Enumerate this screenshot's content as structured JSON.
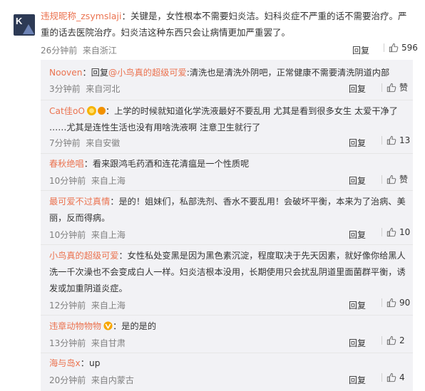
{
  "main_comment": {
    "username": "违规昵称_zsymslaji",
    "separator": "：",
    "text": "关键是，女性根本不需要妇炎洁。妇科炎症不严重的话不需要治疗。严重的话去医院治疗。妇炎洁这种东西只会让病情更加严重罢了。",
    "time": "26分钟前",
    "location": "来自浙江",
    "reply_label": "回复",
    "likes": "596"
  },
  "replies": [
    {
      "username": "Nooven",
      "text_prefix": "：回复",
      "mention": "@小鸟真的超级可爱",
      "text": ":清洗也是清洗外阴吧，正常健康不需要清洗阴道内部",
      "time": "3分钟前",
      "location": "来自河北",
      "reply_label": "回复",
      "likes": "赞"
    },
    {
      "username": "Cat佳oO",
      "text": "：上学的时候就知道化学洗液最好不要乱用 尤其是看到很多女生 太爱干净了 ……尤其是连性生活也没有用啥洗液啊 注意卫生就行了",
      "time": "7分钟前",
      "location": "来自安徽",
      "reply_label": "回复",
      "likes": "13"
    },
    {
      "username": "春秋绝唱",
      "text": "：看来跟鸿毛药酒和连花清瘟是一个性质呢",
      "time": "10分钟前",
      "location": "来自上海",
      "reply_label": "回复",
      "likes": "赞"
    },
    {
      "username": "最可爱不过真情",
      "text": "：是的！姐妹们，私部洗剂、香水不要乱用！会破坏平衡，本来为了治病、美丽，反而得病。",
      "time": "10分钟前",
      "location": "来自上海",
      "reply_label": "回复",
      "likes": "10"
    },
    {
      "username": "小鸟真的超级可爱",
      "text": "：女性私处变黑是因为黑色素沉淀，程度取决于先天因素，就好像你给黑人洗一千次澡也不会变成白人一样。妇炎洁根本没用，长期使用只会扰乱阴道里面菌群平衡，诱发或加重阴道炎症。",
      "time": "12分钟前",
      "location": "来自上海",
      "reply_label": "回复",
      "likes": "90"
    },
    {
      "username": "违章动物物物",
      "text": "：是的是的",
      "time": "13分钟前",
      "location": "来自甘肃",
      "reply_label": "回复",
      "likes": "2"
    },
    {
      "username": "海与岛x",
      "text": "：up",
      "time": "20分钟前",
      "location": "来自内蒙古",
      "reply_label": "回复",
      "likes": "4"
    }
  ],
  "colors": {
    "username": "#eb7350",
    "meta": "#808080",
    "reply_bg": "#f2f2f5"
  }
}
